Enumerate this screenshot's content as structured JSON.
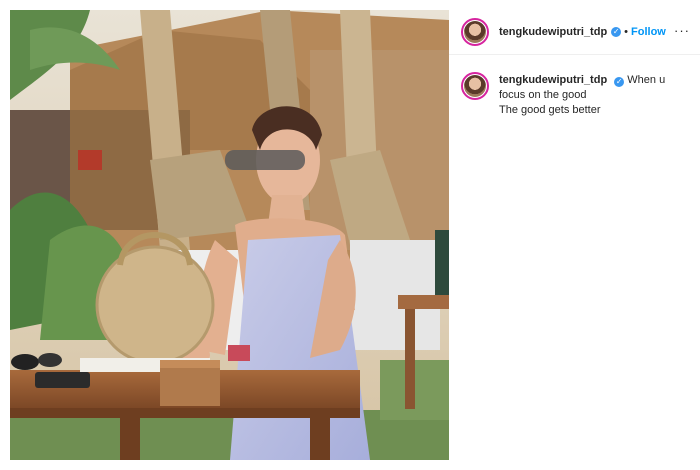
{
  "post": {
    "username": "tengkudewiputri_tdp",
    "verified_icon": "verified-badge-icon",
    "separator": "•",
    "follow_label": "Follow",
    "more_label": "···",
    "caption_first": "When u",
    "caption_lines": [
      "focus on the good",
      "The good gets better"
    ]
  },
  "colors": {
    "accent": "#0095f6",
    "verified": "#3897f0",
    "story_ring": "#d6249f"
  }
}
